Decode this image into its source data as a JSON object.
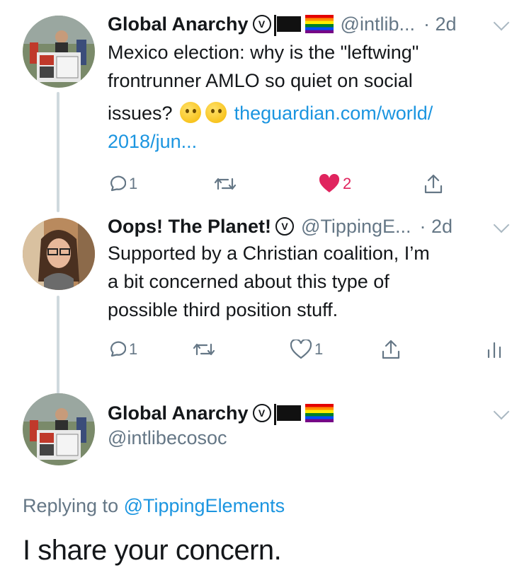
{
  "tweets": [
    {
      "name": "Global Anarchy",
      "handle": "@intlib...",
      "time": "· 2d",
      "text_line1": "Mexico election: why is the \"leftwing\"",
      "text_line2": "frontrunner AMLO so quiet on social",
      "text_line3": "issues?",
      "link_part1": "theguardian.com/world/",
      "link_part2": "2018/jun...",
      "replies": "1",
      "retweets": "",
      "likes": "2",
      "liked": true
    },
    {
      "name": "Oops! The Planet!",
      "handle": "@TippingE...",
      "time": "· 2d",
      "text_line1": "Supported by a Christian coalition,  I’m",
      "text_line2": "a bit concerned about this type of",
      "text_line3": "possible third position stuff.",
      "replies": "1",
      "retweets": "",
      "likes": "1",
      "liked": false
    }
  ],
  "focused": {
    "name": "Global Anarchy",
    "handle": "@intlibecosoc",
    "replying_prefix": "Replying to ",
    "replying_to": "@TippingElements",
    "text": "I share your concern."
  },
  "colors": {
    "link": "#1b95e0",
    "muted": "#657786",
    "like": "#e0245e"
  }
}
